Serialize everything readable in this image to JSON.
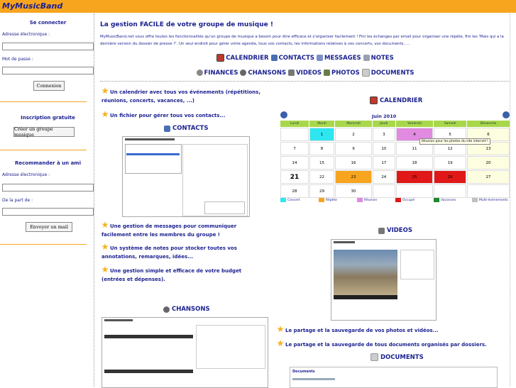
{
  "brand": "MyMusicBand",
  "sidebar": {
    "login": {
      "title": "Se connecter",
      "email_label": "Adresse électronique :",
      "password_label": "Mot de passe :",
      "button": "Connexion"
    },
    "signup": {
      "title": "Inscription gratuite",
      "button": "Créer un groupe musique"
    },
    "recommend": {
      "title": "Recommander à un ami",
      "email_label": "Adresse électronique :",
      "from_label": "De la part de :",
      "button": "Envoyer un mail"
    }
  },
  "main": {
    "title": "La gestion FACILE de votre groupe de musique !",
    "intro": "MyMusicBand.net vous offre toutes les fonctionnalités qu'un groupe de musique a besoin pour être efficace et s'organiser facilement ! Fini les échanges par email pour organiser une répète, fini les 'Mais qui a la dernière version du dossier de presse ?'. Un seul endroit pour gérer votre agenda, tous vos contacts, les informations relatives à vos concerts, vos documents, ...",
    "nav_row1": [
      {
        "label": "CALENDRIER",
        "icon": "calendar-icon",
        "color": "#c0392b"
      },
      {
        "label": "CONTACTS",
        "icon": "contacts-icon",
        "color": "#4a6fb5"
      },
      {
        "label": "MESSAGES",
        "icon": "messages-icon",
        "color": "#7a8fc8"
      },
      {
        "label": "NOTES",
        "icon": "notes-icon",
        "color": "#9aa0b0"
      }
    ],
    "nav_row2": [
      {
        "label": "FINANCES",
        "icon": "finances-icon",
        "color": "#888"
      },
      {
        "label": "CHANSONS",
        "icon": "chansons-icon",
        "color": "#666"
      },
      {
        "label": "VIDEOS",
        "icon": "videos-icon",
        "color": "#777"
      },
      {
        "label": "PHOTOS",
        "icon": "photos-icon",
        "color": "#6a7a4a"
      },
      {
        "label": "DOCUMENTS",
        "icon": "documents-icon",
        "color": "#999"
      }
    ],
    "features": {
      "calendar": "Un calendrier avec tous vos événements (répétitions, réunions, concerts, vacances, ...)",
      "contacts": "Un fichier pour gérer tous vos contacts...",
      "messages": "Une gestion de messages pour communiquer facilement entre les membres du groupe !",
      "notes": "Un système de notes pour stocker toutes vos annotations, remarques, idées...",
      "budget": "Une gestion simple et efficace de votre budget (entrées et dépenses).",
      "photos": "Le partage et la sauvegarde de vos photos et vidéos...",
      "documents": "Le partage et la sauvegarde de tous documents organisés par dossiers."
    },
    "sections": {
      "contacts": "CONTACTS",
      "calendar": "CALENDRIER",
      "videos": "VIDEOS",
      "chansons": "CHANSONS",
      "documents": "DOCUMENTS"
    },
    "calendar": {
      "month": "Juin 2010",
      "days": [
        "Lundi",
        "Mardi",
        "Mercredi",
        "Jeudi",
        "Vendredi",
        "Samedi",
        "Dimanche"
      ],
      "weeks": [
        [
          "",
          "1",
          "2",
          "3",
          "4",
          "5",
          "6"
        ],
        [
          "7",
          "8",
          "9",
          "10",
          "11",
          "12",
          "13"
        ],
        [
          "14",
          "15",
          "16",
          "17",
          "18",
          "19",
          "20"
        ],
        [
          "21",
          "22",
          "23",
          "24",
          "25",
          "26",
          "27"
        ],
        [
          "28",
          "29",
          "30",
          "",
          "",
          "",
          ""
        ]
      ],
      "tooltip": "Réunion pour les photos du site internet !",
      "legend": [
        {
          "label": "Concert",
          "color": "#2ee6f0"
        },
        {
          "label": "Répète",
          "color": "#f7a41f"
        },
        {
          "label": "Réunion",
          "color": "#e08ae0"
        },
        {
          "label": "Occupé",
          "color": "#e01818"
        },
        {
          "label": "Vacances",
          "color": "#1a8a2a"
        },
        {
          "label": "Multi-événements",
          "color": "#c0c0c0"
        }
      ]
    },
    "documents_box_title": "Documents"
  }
}
